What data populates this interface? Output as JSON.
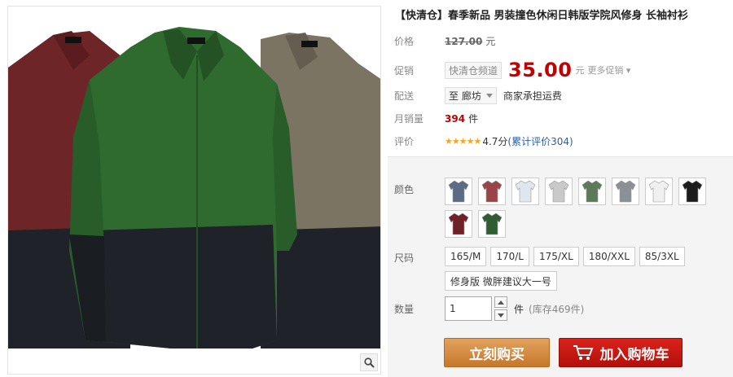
{
  "product": {
    "title": "【快清仓】春季新品 男装撞色休闲日韩版学院风修身 长袖衬衫"
  },
  "price_row": {
    "label": "价格",
    "original_price": "127.00",
    "unit": "元"
  },
  "promo_row": {
    "label": "促销",
    "tag": "快清仓频道",
    "price": "35.00",
    "unit": "元",
    "more": "更多促销"
  },
  "shipping_row": {
    "label": "配送",
    "location": "至 廊坊",
    "note": "商家承担运费"
  },
  "sales_row": {
    "label": "月销量",
    "count": "394",
    "unit": "件"
  },
  "rating_row": {
    "label": "评价",
    "stars": "★★★★★",
    "score": "4.7分",
    "reviews": "(累计评价304)"
  },
  "options": {
    "color_label": "颜色",
    "colors": [
      {
        "name": "blue-plaid",
        "color": "#5a6b84"
      },
      {
        "name": "red-plaid",
        "color": "#9a4448"
      },
      {
        "name": "white-blue",
        "color": "#dfe6ee"
      },
      {
        "name": "white-plaid",
        "color": "#c9c9c9"
      },
      {
        "name": "green-plaid",
        "color": "#5d7a58"
      },
      {
        "name": "grey-plaid",
        "color": "#8b8f96"
      },
      {
        "name": "white",
        "color": "#f0f0f0"
      },
      {
        "name": "black",
        "color": "#1c1c1c"
      },
      {
        "name": "wine",
        "color": "#6e2228"
      },
      {
        "name": "green",
        "color": "#2f5c30"
      }
    ],
    "size_label": "尺码",
    "sizes": [
      "165/M",
      "170/L",
      "175/XL",
      "180/XXL",
      "85/3XL",
      "修身版 微胖建议大一号"
    ],
    "qty_label": "数量",
    "qty_value": "1",
    "qty_unit": "件",
    "stock": "(库存469件)"
  },
  "actions": {
    "buy": "立刻购买",
    "cart": "加入购物车"
  },
  "image": {
    "shirt_colors": {
      "left": "#6e2528",
      "center": "#2f6a2f",
      "right": "#7b7463",
      "bottom": "#1f2228"
    }
  }
}
